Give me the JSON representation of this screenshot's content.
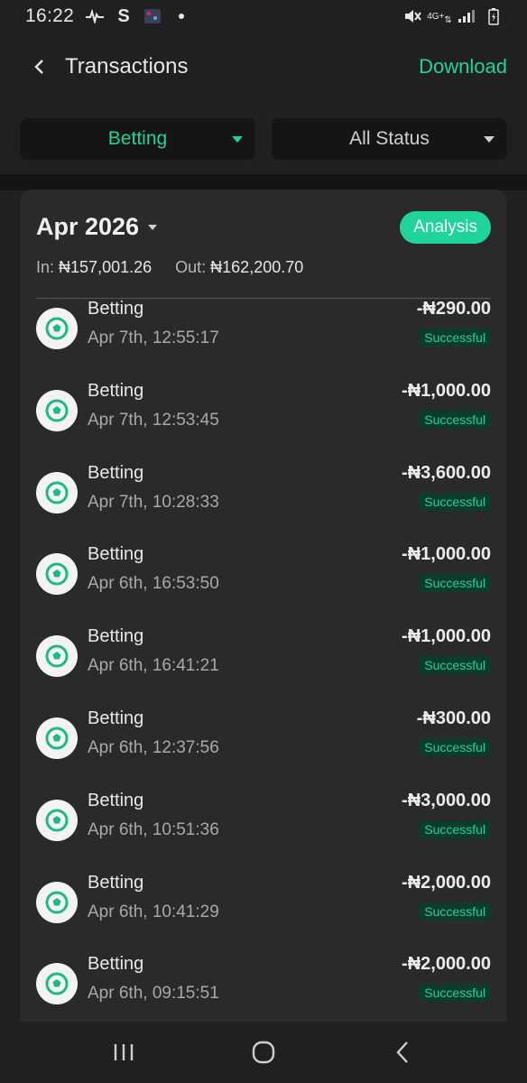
{
  "status_bar": {
    "time": "16:22",
    "left_icons": [
      "activity-icon",
      "s-app-icon",
      "app-thumbnail-icon",
      "dot-icon"
    ],
    "right_icons": [
      "mute-icon",
      "4g-data-icon",
      "signal-icon",
      "battery-charging-icon"
    ],
    "network_label": "4G+"
  },
  "header": {
    "title": "Transactions",
    "download_label": "Download"
  },
  "filters": {
    "category": "Betting",
    "status": "All Status"
  },
  "summary": {
    "month": "Apr 2026",
    "analysis_label": "Analysis",
    "in_label": "In:",
    "in_value": "₦157,001.26",
    "out_label": "Out:",
    "out_value": "₦162,200.70"
  },
  "transactions": [
    {
      "name": "Betting",
      "date": "Apr 7th, 12:55:17",
      "amount": "-₦290.00",
      "status": "Successful"
    },
    {
      "name": "Betting",
      "date": "Apr 7th, 12:53:45",
      "amount": "-₦1,000.00",
      "status": "Successful"
    },
    {
      "name": "Betting",
      "date": "Apr 7th, 10:28:33",
      "amount": "-₦3,600.00",
      "status": "Successful"
    },
    {
      "name": "Betting",
      "date": "Apr 6th, 16:53:50",
      "amount": "-₦1,000.00",
      "status": "Successful"
    },
    {
      "name": "Betting",
      "date": "Apr 6th, 16:41:21",
      "amount": "-₦1,000.00",
      "status": "Successful"
    },
    {
      "name": "Betting",
      "date": "Apr 6th, 12:37:56",
      "amount": "-₦300.00",
      "status": "Successful"
    },
    {
      "name": "Betting",
      "date": "Apr 6th, 10:51:36",
      "amount": "-₦3,000.00",
      "status": "Successful"
    },
    {
      "name": "Betting",
      "date": "Apr 6th, 10:41:29",
      "amount": "-₦2,000.00",
      "status": "Successful"
    },
    {
      "name": "Betting",
      "date": "Apr 6th, 09:15:51",
      "amount": "-₦2,000.00",
      "status": "Successful"
    }
  ],
  "nav_bar": [
    "recents-icon",
    "home-icon",
    "back-icon"
  ],
  "colors": {
    "accent": "#1fd39b",
    "background": "#202020",
    "card": "#2a2a2a",
    "badge_bg": "#0d3b2c"
  }
}
